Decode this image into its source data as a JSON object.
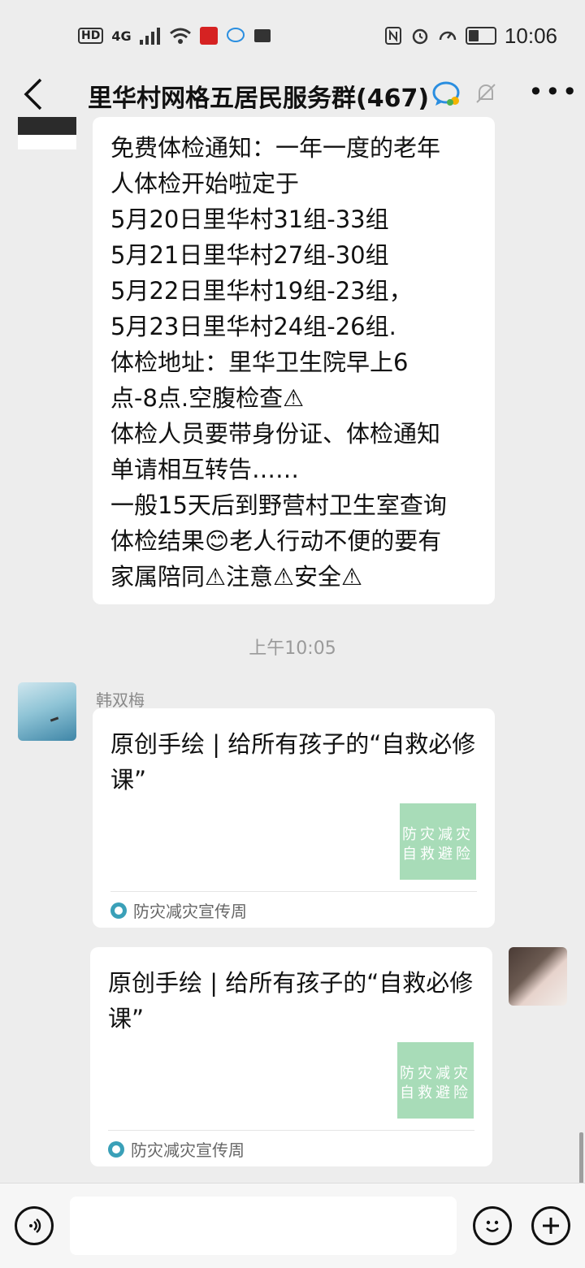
{
  "status_bar": {
    "hd": "HD",
    "signal": "4G",
    "time": "10:06"
  },
  "header": {
    "title": "里华村网格五居民服务群(467)",
    "icons": [
      "back-icon",
      "group-chat-icon",
      "mute-bell-icon",
      "more-icon"
    ]
  },
  "messages": {
    "notice_text": "免费体检通知：一年一度的老年\n人体检开始啦定于\n5月20日里华村31组-33组\n5月21日里华村27组-30组\n5月22日里华村19组-23组，\n5月23日里华村24组-26组.\n体检地址：里华卫生院早上6\n点-8点.空腹检查⚠\n体检人员要带身份证、体检通知\n单请相互转告……\n一般15天后到野营村卫生室查询\n体检结果😊老人行动不便的要有\n家属陪同⚠注意⚠安全⚠",
    "time_separator": "上午10:05",
    "sender_name": "韩双梅",
    "shared_card_1": {
      "title": "原创手绘 | 给所有孩子的“自救必修课”",
      "thumb_line_1": "防灾减灾",
      "thumb_line_2": "自救避险",
      "source": "防灾减灾宣传周"
    },
    "shared_card_2": {
      "title": "原创手绘 | 给所有孩子的“自救必修课”",
      "thumb_line_1": "防灾减灾",
      "thumb_line_2": "自救避险",
      "source": "防灾减灾宣传周"
    }
  },
  "input_bar": {
    "placeholder": ""
  },
  "colors": {
    "background": "#ededed",
    "bubble": "#ffffff",
    "thumb_green": "#a8dcb8"
  }
}
